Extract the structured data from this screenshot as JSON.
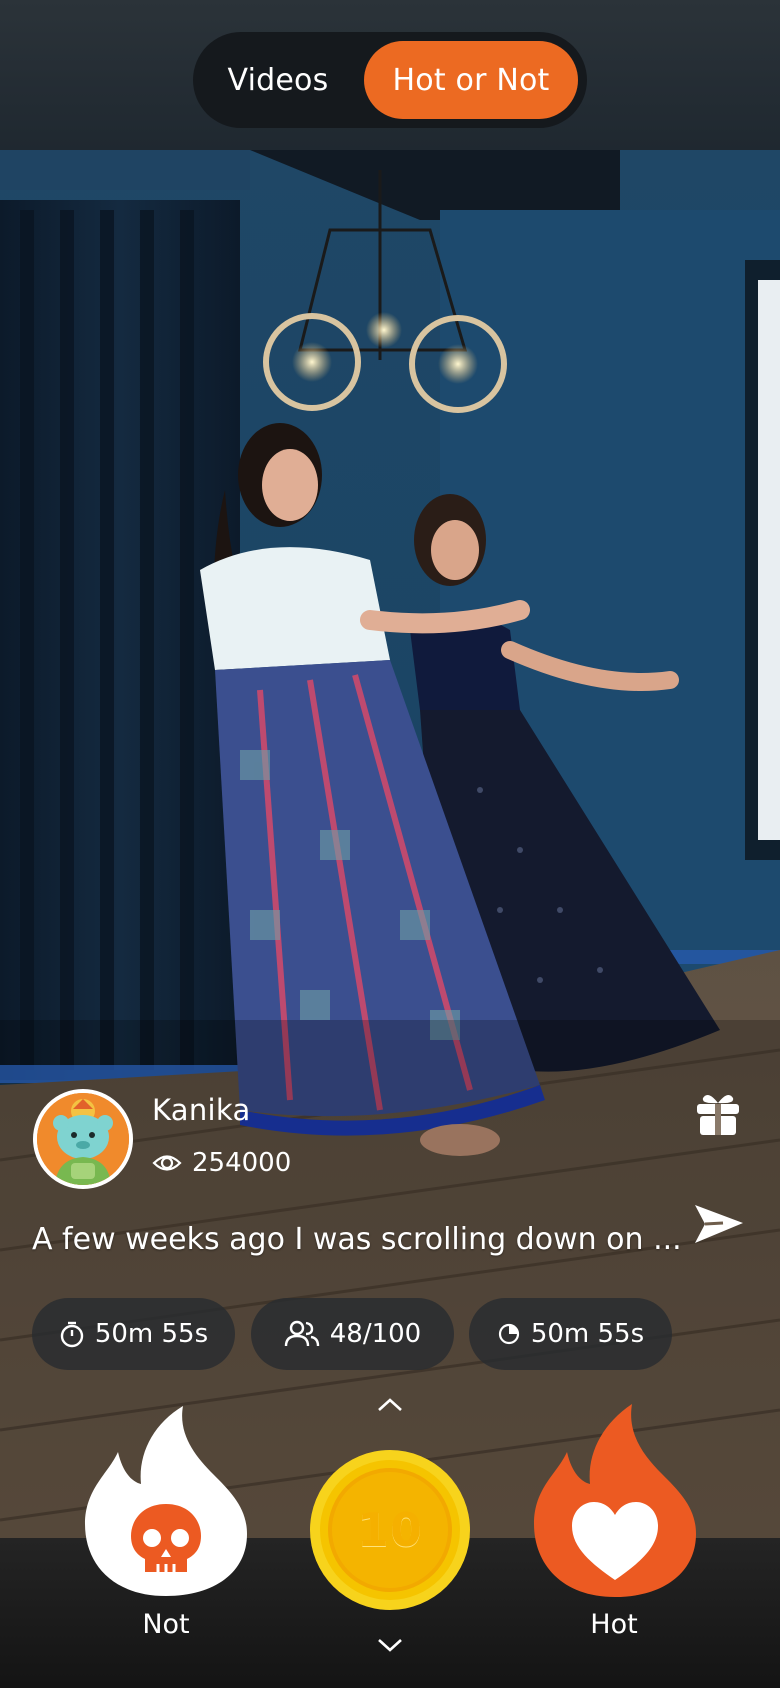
{
  "tabs": {
    "videos": "Videos",
    "hot_or_not": "Hot or Not",
    "active": "Hot or Not"
  },
  "creator": {
    "name": "Kanika",
    "views": "254000",
    "avatar_icon": "bear-avatar-icon"
  },
  "post": {
    "caption": "A few weeks ago I was scrolling down on ..."
  },
  "stats": {
    "timer": "50m 55s",
    "participants": "48/100",
    "time_left": "50m 55s"
  },
  "voting": {
    "not_label": "Not",
    "hot_label": "Hot",
    "coin_value": "10"
  },
  "colors": {
    "accent": "#ec6a22",
    "coin": "#f5c400",
    "not_flame": "#ffffff",
    "hot_flame": "#ec5a22"
  }
}
